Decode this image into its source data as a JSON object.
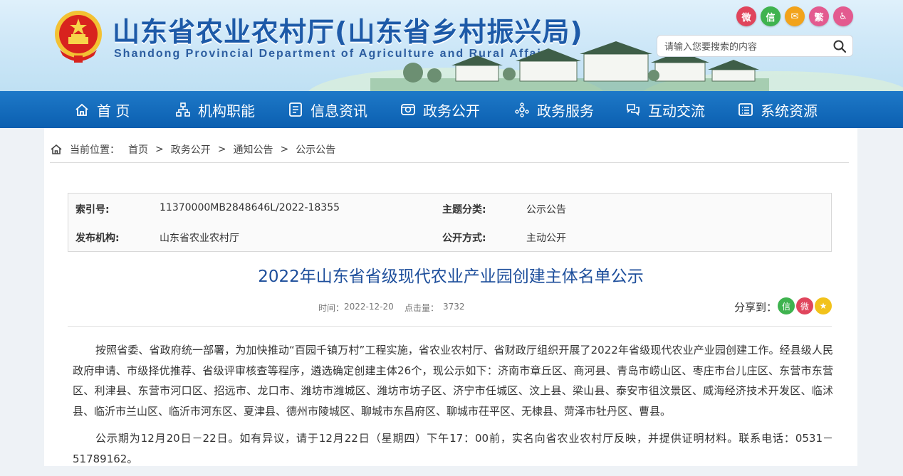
{
  "header": {
    "title_cn": "山东省农业农村厅(山东省乡村振兴局)",
    "title_en": "Shandong Provincial Department of Agriculture and Rural Affairs",
    "social": [
      {
        "icon": "weibo-icon",
        "color": "#e0455c",
        "glyph": "微"
      },
      {
        "icon": "wechat-icon",
        "color": "#3fb34f",
        "glyph": "信"
      },
      {
        "icon": "mail-icon",
        "color": "#f2a31b",
        "glyph": "✉"
      },
      {
        "icon": "traditional-chinese-icon",
        "color": "#e35a8f",
        "glyph": "繁"
      },
      {
        "icon": "accessibility-icon",
        "color": "#e35a8f",
        "glyph": "♿"
      }
    ],
    "search_placeholder": "请输入您要搜索的内容"
  },
  "nav": [
    {
      "label": "首 页",
      "icon": "home-icon"
    },
    {
      "label": "机构职能",
      "icon": "org-chart-icon"
    },
    {
      "label": "信息资讯",
      "icon": "document-icon"
    },
    {
      "label": "政务公开",
      "icon": "open-government-icon"
    },
    {
      "label": "政务服务",
      "icon": "service-icon"
    },
    {
      "label": "互动交流",
      "icon": "interaction-icon"
    },
    {
      "label": "系统资源",
      "icon": "system-resource-icon"
    }
  ],
  "breadcrumb": {
    "prefix": "当前位置：",
    "items": [
      "首页",
      "政务公开",
      "通知公告",
      "公示公告"
    ],
    "sep": ">"
  },
  "meta": {
    "index_label": "索引号:",
    "index_value": "11370000MB2848646L/2022-18355",
    "topic_label": "主题分类:",
    "topic_value": "公示公告",
    "publisher_label": "发布机构:",
    "publisher_value": "山东省农业农村厅",
    "method_label": "公开方式:",
    "method_value": "主动公开"
  },
  "article": {
    "title": "2022年山东省省级现代农业产业园创建主体名单公示",
    "time_label": "时间：",
    "time_value": "2022-12-20",
    "hits_label": "点击量：",
    "hits_value": "3732",
    "share_label": "分享到：",
    "share": [
      {
        "icon": "wechat-share-icon",
        "color": "#3fb34f",
        "glyph": "信"
      },
      {
        "icon": "weibo-share-icon",
        "color": "#e0455c",
        "glyph": "微"
      },
      {
        "icon": "qzone-share-icon",
        "color": "#f2c21b",
        "glyph": "★"
      }
    ],
    "paragraphs": [
      "按照省委、省政府统一部署，为加快推动“百园千镇万村”工程实施，省农业农村厅、省财政厅组织开展了2022年省级现代农业产业园创建工作。经县级人民政府申请、市级择优推荐、省级评审核查等程序，遴选确定创建主体26个，现公示如下：济南市章丘区、商河县、青岛市崂山区、枣庄市台儿庄区、东营市东营区、利津县、东营市河口区、招远市、龙口市、潍坊市潍城区、潍坊市坊子区、济宁市任城区、汶上县、梁山县、泰安市徂汶景区、威海经济技术开发区、临沭县、临沂市兰山区、临沂市河东区、夏津县、德州市陵城区、聊城市东昌府区、聊城市茌平区、无棣县、菏泽市牡丹区、曹县。",
      "公示期为12月20日－22日。如有异议，请于12月22日（星期四）下午17：00前，实名向省农业农村厅反映，并提供证明材料。联系电话：0531－51789162。"
    ]
  }
}
